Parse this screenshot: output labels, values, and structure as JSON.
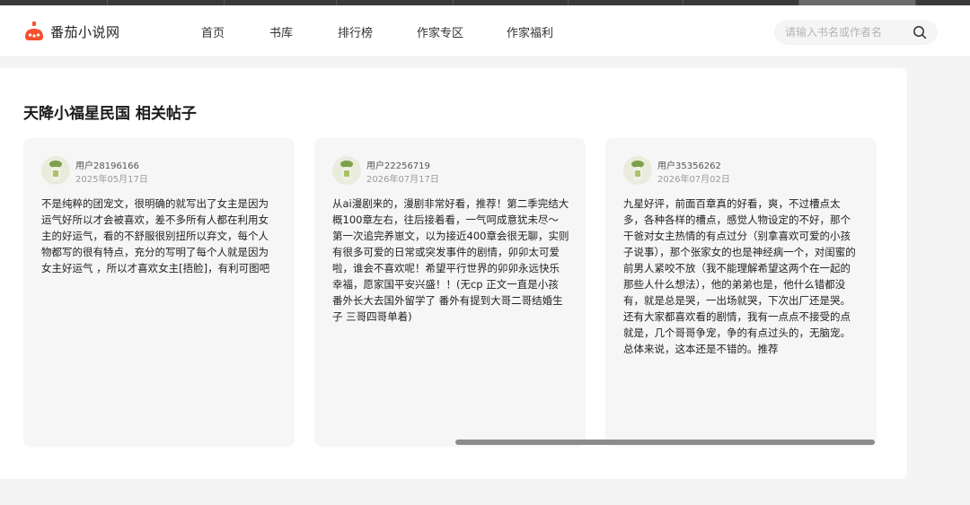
{
  "header": {
    "logo_text": "番茄小说网",
    "nav": [
      "首页",
      "书库",
      "排行榜",
      "作家专区",
      "作家福利"
    ],
    "search_placeholder": "请输入书名或作者名"
  },
  "section": {
    "title": "天降小福星民国 相关帖子"
  },
  "posts": [
    {
      "user": "用户28196166",
      "date": "2025年05月17日",
      "content": "不是纯粹的团宠文，很明确的就写出了女主是因为运气好所以才会被喜欢，差不多所有人都在利用女主的好运气，看的不舒服很别扭所以弃文，每个人物都写的很有特点，充分的写明了每个人就是因为女主好运气 ，所以才喜欢女主[捂脸]，有利可图吧"
    },
    {
      "user": "用户22256719",
      "date": "2026年07月17日",
      "content": "从ai漫剧来的，漫剧非常好看，推荐！第二季完结大概100章左右，往后接着看，一气呵成意犹未尽～ 第一次追完养崽文，以为接近400章会很无聊，实则有很多可爱的日常或突发事件的剧情，卯卯太可爱啦，谁会不喜欢呢！希望平行世界的卯卯永远快乐幸福，愿家国平安兴盛！！(无cp 正文一直是小孩 番外长大去国外留学了 番外有提到大哥二哥结婚生子 三哥四哥单着)"
    },
    {
      "user": "用户35356262",
      "date": "2026年07月02日",
      "content": "九星好评，前面百章真的好看，爽，不过槽点太多，各种各样的槽点，感觉人物设定的不好，那个干爸对女主热情的有点过分（别拿喜欢可爱的小孩子说事），那个张家女的也是神经病一个，对闺蜜的前男人紧咬不放（我不能理解希望这两个在一起的那些人什么想法），他的弟弟也是，他什么错都没有，就是总是哭，一出场就哭，下次出厂还是哭。还有大家都喜欢看的剧情，我有一点点不接受的点就是，几个哥哥争宠，争的有点过头的，无脑宠。总体来说，这本还是不错的。推荐"
    }
  ],
  "colors": {
    "logo_accent": "#f5522d",
    "text_primary": "#222222",
    "text_secondary": "#9a9a9a",
    "card_bg": "#f6f6f6"
  }
}
